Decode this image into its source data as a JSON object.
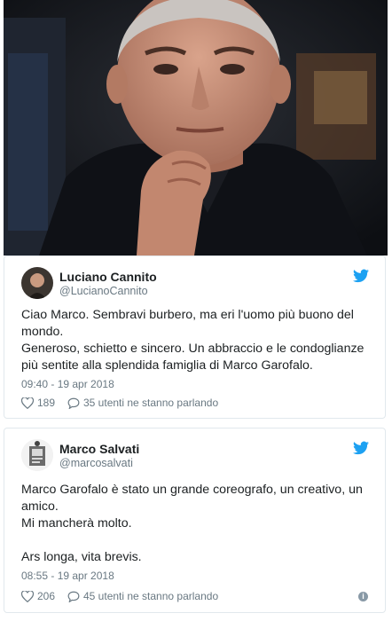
{
  "tweets": [
    {
      "name": "Luciano Cannito",
      "handle": "@LucianoCannito",
      "text": "Ciao Marco. Sembravi burbero, ma eri l'uomo più buono del\nmondo.\nGeneroso, schietto e sincero. Un abbraccio e le condoglianze\npiù sentite alla splendida famiglia di Marco Garofalo.",
      "time": "09:40 - 19 apr 2018",
      "likes": "189",
      "replies": "35 utenti ne stanno parlando"
    },
    {
      "name": "Marco Salvati",
      "handle": "@marcosalvati",
      "text": "Marco Garofalo è stato un grande coreografo, un creativo, un\namico.\nMi mancherà molto.\n\nArs longa, vita brevis.",
      "time": "08:55 - 19 apr 2018",
      "likes": "206",
      "replies": "45 utenti ne stanno parlando"
    }
  ],
  "icons": {
    "brand": "twitter-bird-icon",
    "like": "heart-icon",
    "reply": "speech-bubble-icon",
    "info": "info-icon"
  },
  "colors": {
    "twitter_blue": "#1da1f2",
    "meta_gray": "#697882",
    "border": "#e1e8ed",
    "text": "#1c2022"
  }
}
